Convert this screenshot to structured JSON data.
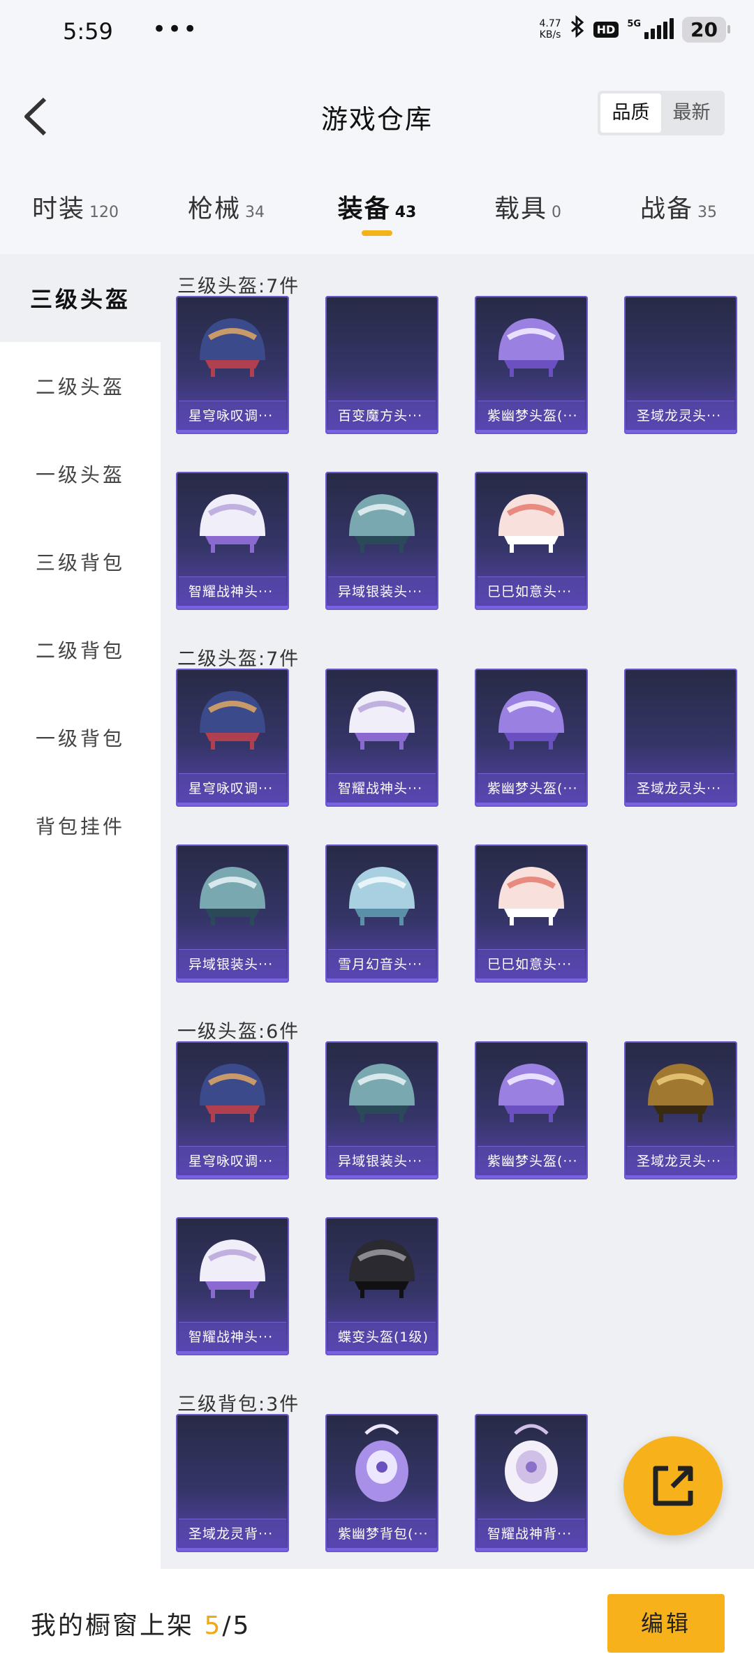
{
  "status_bar": {
    "time": "5:59",
    "dots": "•••",
    "speed_value": "4.77",
    "speed_unit": "KB/s",
    "hd": "HD",
    "network": "5G",
    "battery": "20"
  },
  "header": {
    "title": "游戏仓库",
    "sort_options": [
      "品质",
      "最新"
    ],
    "active_sort": "品质"
  },
  "tabs": [
    {
      "label": "时装",
      "count": "120"
    },
    {
      "label": "枪械",
      "count": "34"
    },
    {
      "label": "装备",
      "count": "43",
      "active": true
    },
    {
      "label": "载具",
      "count": "0"
    },
    {
      "label": "战备",
      "count": "35"
    }
  ],
  "sidebar": {
    "items": [
      "三级头盔",
      "二级头盔",
      "一级头盔",
      "三级背包",
      "二级背包",
      "一级背包",
      "背包挂件"
    ],
    "active": "三级头盔"
  },
  "sections": [
    {
      "title": "三级头盔:7件",
      "items": [
        {
          "name": "星穹咏叹调···",
          "icon": "helmet-ornate-icon"
        },
        {
          "name": "百变魔方头···",
          "icon": "empty-slot"
        },
        {
          "name": "紫幽梦头盔(···",
          "icon": "helmet-purple-icon"
        },
        {
          "name": "圣域龙灵头···",
          "icon": "empty-slot"
        },
        {
          "name": "智耀战神头···",
          "icon": "helmet-white-icon"
        },
        {
          "name": "异域银装头···",
          "icon": "helmet-teal-icon"
        },
        {
          "name": "巳巳如意头···",
          "icon": "helmet-pink-icon"
        }
      ]
    },
    {
      "title": "二级头盔:7件",
      "items": [
        {
          "name": "星穹咏叹调···",
          "icon": "helmet-ornate-icon"
        },
        {
          "name": "智耀战神头···",
          "icon": "helmet-white-icon"
        },
        {
          "name": "紫幽梦头盔(···",
          "icon": "helmet-purple-icon"
        },
        {
          "name": "圣域龙灵头···",
          "icon": "empty-slot"
        },
        {
          "name": "异域银装头···",
          "icon": "helmet-teal-icon"
        },
        {
          "name": "雪月幻音头···",
          "icon": "helmet-lightblue-icon"
        },
        {
          "name": "巳巳如意头···",
          "icon": "helmet-pink-icon"
        }
      ]
    },
    {
      "title": "一级头盔:6件",
      "items": [
        {
          "name": "星穹咏叹调···",
          "icon": "helmet-ornate-icon"
        },
        {
          "name": "异域银装头···",
          "icon": "helmet-teal-icon"
        },
        {
          "name": "紫幽梦头盔(···",
          "icon": "helmet-purple-icon"
        },
        {
          "name": "圣域龙灵头···",
          "icon": "helmet-gold-icon"
        },
        {
          "name": "智耀战神头···",
          "icon": "helmet-white-icon"
        },
        {
          "name": "蝶变头盔(1级)",
          "icon": "helmet-black-icon"
        }
      ]
    },
    {
      "title": "三级背包:3件",
      "items": [
        {
          "name": "圣域龙灵背···",
          "icon": "empty-slot"
        },
        {
          "name": "紫幽梦背包(···",
          "icon": "backpack-purple-icon"
        },
        {
          "name": "智耀战神背···",
          "icon": "backpack-white-icon"
        }
      ]
    }
  ],
  "bottom_bar": {
    "label": "我的橱窗上架",
    "current": "5",
    "separator": "/",
    "total": "5",
    "edit_label": "编辑"
  },
  "colors": {
    "accent": "#f7b11b",
    "card_top": "#272a45",
    "card_bottom": "#5a45b0"
  }
}
